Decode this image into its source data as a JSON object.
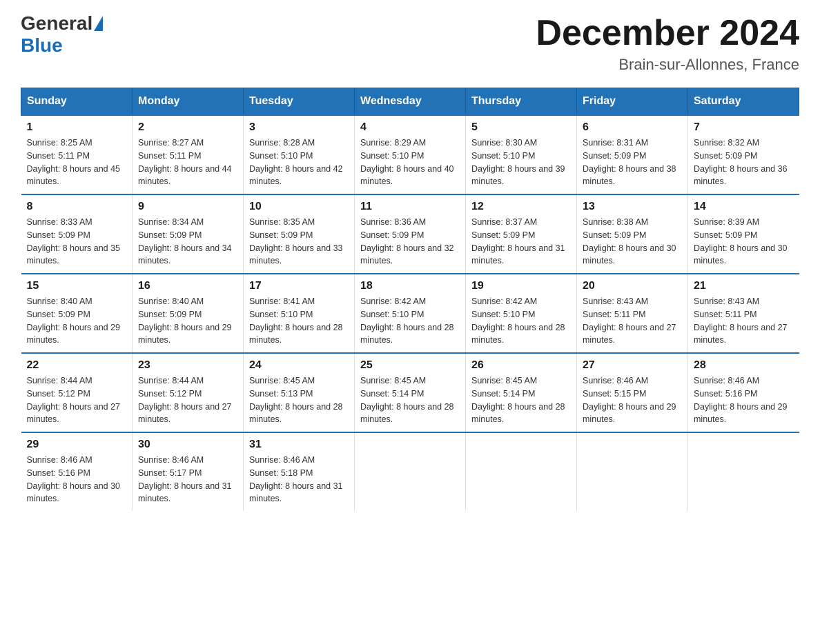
{
  "header": {
    "logo_general": "General",
    "logo_blue": "Blue",
    "month_title": "December 2024",
    "location": "Brain-sur-Allonnes, France"
  },
  "days_of_week": [
    "Sunday",
    "Monday",
    "Tuesday",
    "Wednesday",
    "Thursday",
    "Friday",
    "Saturday"
  ],
  "weeks": [
    [
      {
        "day": "1",
        "sunrise": "8:25 AM",
        "sunset": "5:11 PM",
        "daylight": "8 hours and 45 minutes."
      },
      {
        "day": "2",
        "sunrise": "8:27 AM",
        "sunset": "5:11 PM",
        "daylight": "8 hours and 44 minutes."
      },
      {
        "day": "3",
        "sunrise": "8:28 AM",
        "sunset": "5:10 PM",
        "daylight": "8 hours and 42 minutes."
      },
      {
        "day": "4",
        "sunrise": "8:29 AM",
        "sunset": "5:10 PM",
        "daylight": "8 hours and 40 minutes."
      },
      {
        "day": "5",
        "sunrise": "8:30 AM",
        "sunset": "5:10 PM",
        "daylight": "8 hours and 39 minutes."
      },
      {
        "day": "6",
        "sunrise": "8:31 AM",
        "sunset": "5:09 PM",
        "daylight": "8 hours and 38 minutes."
      },
      {
        "day": "7",
        "sunrise": "8:32 AM",
        "sunset": "5:09 PM",
        "daylight": "8 hours and 36 minutes."
      }
    ],
    [
      {
        "day": "8",
        "sunrise": "8:33 AM",
        "sunset": "5:09 PM",
        "daylight": "8 hours and 35 minutes."
      },
      {
        "day": "9",
        "sunrise": "8:34 AM",
        "sunset": "5:09 PM",
        "daylight": "8 hours and 34 minutes."
      },
      {
        "day": "10",
        "sunrise": "8:35 AM",
        "sunset": "5:09 PM",
        "daylight": "8 hours and 33 minutes."
      },
      {
        "day": "11",
        "sunrise": "8:36 AM",
        "sunset": "5:09 PM",
        "daylight": "8 hours and 32 minutes."
      },
      {
        "day": "12",
        "sunrise": "8:37 AM",
        "sunset": "5:09 PM",
        "daylight": "8 hours and 31 minutes."
      },
      {
        "day": "13",
        "sunrise": "8:38 AM",
        "sunset": "5:09 PM",
        "daylight": "8 hours and 30 minutes."
      },
      {
        "day": "14",
        "sunrise": "8:39 AM",
        "sunset": "5:09 PM",
        "daylight": "8 hours and 30 minutes."
      }
    ],
    [
      {
        "day": "15",
        "sunrise": "8:40 AM",
        "sunset": "5:09 PM",
        "daylight": "8 hours and 29 minutes."
      },
      {
        "day": "16",
        "sunrise": "8:40 AM",
        "sunset": "5:09 PM",
        "daylight": "8 hours and 29 minutes."
      },
      {
        "day": "17",
        "sunrise": "8:41 AM",
        "sunset": "5:10 PM",
        "daylight": "8 hours and 28 minutes."
      },
      {
        "day": "18",
        "sunrise": "8:42 AM",
        "sunset": "5:10 PM",
        "daylight": "8 hours and 28 minutes."
      },
      {
        "day": "19",
        "sunrise": "8:42 AM",
        "sunset": "5:10 PM",
        "daylight": "8 hours and 28 minutes."
      },
      {
        "day": "20",
        "sunrise": "8:43 AM",
        "sunset": "5:11 PM",
        "daylight": "8 hours and 27 minutes."
      },
      {
        "day": "21",
        "sunrise": "8:43 AM",
        "sunset": "5:11 PM",
        "daylight": "8 hours and 27 minutes."
      }
    ],
    [
      {
        "day": "22",
        "sunrise": "8:44 AM",
        "sunset": "5:12 PM",
        "daylight": "8 hours and 27 minutes."
      },
      {
        "day": "23",
        "sunrise": "8:44 AM",
        "sunset": "5:12 PM",
        "daylight": "8 hours and 27 minutes."
      },
      {
        "day": "24",
        "sunrise": "8:45 AM",
        "sunset": "5:13 PM",
        "daylight": "8 hours and 28 minutes."
      },
      {
        "day": "25",
        "sunrise": "8:45 AM",
        "sunset": "5:14 PM",
        "daylight": "8 hours and 28 minutes."
      },
      {
        "day": "26",
        "sunrise": "8:45 AM",
        "sunset": "5:14 PM",
        "daylight": "8 hours and 28 minutes."
      },
      {
        "day": "27",
        "sunrise": "8:46 AM",
        "sunset": "5:15 PM",
        "daylight": "8 hours and 29 minutes."
      },
      {
        "day": "28",
        "sunrise": "8:46 AM",
        "sunset": "5:16 PM",
        "daylight": "8 hours and 29 minutes."
      }
    ],
    [
      {
        "day": "29",
        "sunrise": "8:46 AM",
        "sunset": "5:16 PM",
        "daylight": "8 hours and 30 minutes."
      },
      {
        "day": "30",
        "sunrise": "8:46 AM",
        "sunset": "5:17 PM",
        "daylight": "8 hours and 31 minutes."
      },
      {
        "day": "31",
        "sunrise": "8:46 AM",
        "sunset": "5:18 PM",
        "daylight": "8 hours and 31 minutes."
      },
      null,
      null,
      null,
      null
    ]
  ]
}
